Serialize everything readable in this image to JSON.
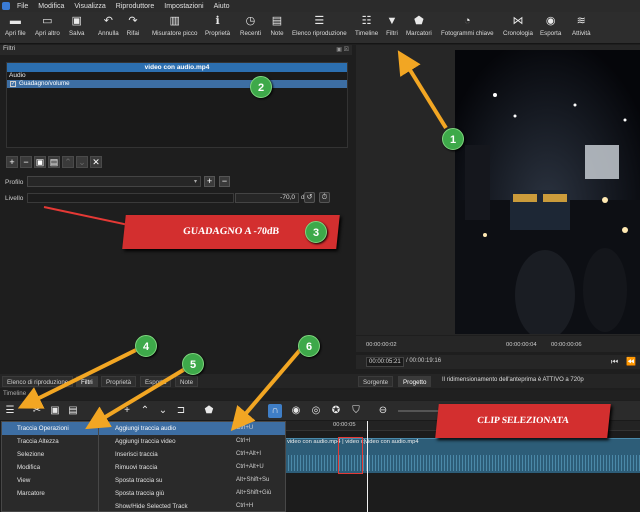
{
  "menubar": {
    "items": [
      "File",
      "Modifica",
      "Visualizza",
      "Riproduttore",
      "Impostazioni",
      "Aiuto"
    ]
  },
  "toolbar": {
    "buttons": [
      {
        "label": "Apri file",
        "icon": "folder-icon"
      },
      {
        "label": "Apri altro",
        "icon": "folder-open-icon"
      },
      {
        "label": "Salva",
        "icon": "save-icon"
      },
      {
        "label": "Annulla",
        "icon": "undo-icon"
      },
      {
        "label": "Rifai",
        "icon": "redo-icon"
      },
      {
        "label": "Misuratore picco",
        "icon": "peak-meter-icon"
      },
      {
        "label": "Proprietà",
        "icon": "info-icon"
      },
      {
        "label": "Recenti",
        "icon": "clock-icon"
      },
      {
        "label": "Note",
        "icon": "notes-icon"
      },
      {
        "label": "Elenco riproduzione",
        "icon": "playlist-icon"
      },
      {
        "label": "Timeline",
        "icon": "timeline-icon"
      },
      {
        "label": "Filtri",
        "icon": "filter-icon"
      },
      {
        "label": "Marcatori",
        "icon": "marker-icon"
      },
      {
        "label": "Fotogrammi chiave",
        "icon": "keyframes-icon"
      },
      {
        "label": "Cronologia",
        "icon": "history-icon"
      },
      {
        "label": "Esporta",
        "icon": "export-icon"
      },
      {
        "label": "Attività",
        "icon": "jobs-icon"
      }
    ]
  },
  "filters": {
    "panel_title": "Filtri",
    "clip_name": "video con audio.mp4",
    "category": "Audio",
    "applied_filter": "Guadagno/volume",
    "profilo_label": "Profilo",
    "livello_label": "Livello",
    "livello_value": "-70,0",
    "livello_unit": "dB"
  },
  "annotations": {
    "guadagno": "GUADAGNO A -70dB",
    "clip_selezionata": "CLIP SELEZIONATA",
    "badges": [
      "1",
      "2",
      "3",
      "4",
      "5",
      "6"
    ]
  },
  "preview": {
    "ruler_ticks": [
      "00:00:00:02",
      "00:00:00:04",
      "00:00:00:06"
    ],
    "current_time": "00:00:05:21",
    "total_time": "/ 00:00:19:16",
    "tabs": [
      "Sorgente",
      "Progetto"
    ],
    "scale_note": "Il ridimensionamento dell'anteprima è ATTIVO a 720p"
  },
  "lower_tabs": [
    "Elenco di riproduzione",
    "Filtri",
    "Proprietà",
    "Esporta",
    "Note"
  ],
  "timeline": {
    "title": "Timeline",
    "ruler_tick": "00:00:05",
    "clip_name": "video con audio.mp4 | video c|video con audio.mp4"
  },
  "context_menu": {
    "items": [
      "Traccia Operazioni",
      "Traccia Altezza",
      "Selezione",
      "Modifica",
      "View",
      "Marcatore"
    ],
    "selected": "Traccia Operazioni"
  },
  "submenu": {
    "items": [
      {
        "label": "Aggiungi traccia audio",
        "shortcut": "Ctrl+U"
      },
      {
        "label": "Aggiungi traccia video",
        "shortcut": "Ctrl+I"
      },
      {
        "label": "Inserisci traccia",
        "shortcut": "Ctrl+Alt+I"
      },
      {
        "label": "Rimuovi traccia",
        "shortcut": "Ctrl+Alt+U"
      },
      {
        "label": "Sposta traccia su",
        "shortcut": "Alt+Shift+Su"
      },
      {
        "label": "Sposta traccia giù",
        "shortcut": "Alt+Shift+Giù"
      },
      {
        "label": "Show/Hide Selected Track",
        "shortcut": "Ctrl+H"
      }
    ]
  },
  "colors": {
    "accent": "#3d6ea3",
    "annotation_red": "#d32f2f",
    "arrow": "#f2a623",
    "badge_green": "#3ea94a"
  }
}
